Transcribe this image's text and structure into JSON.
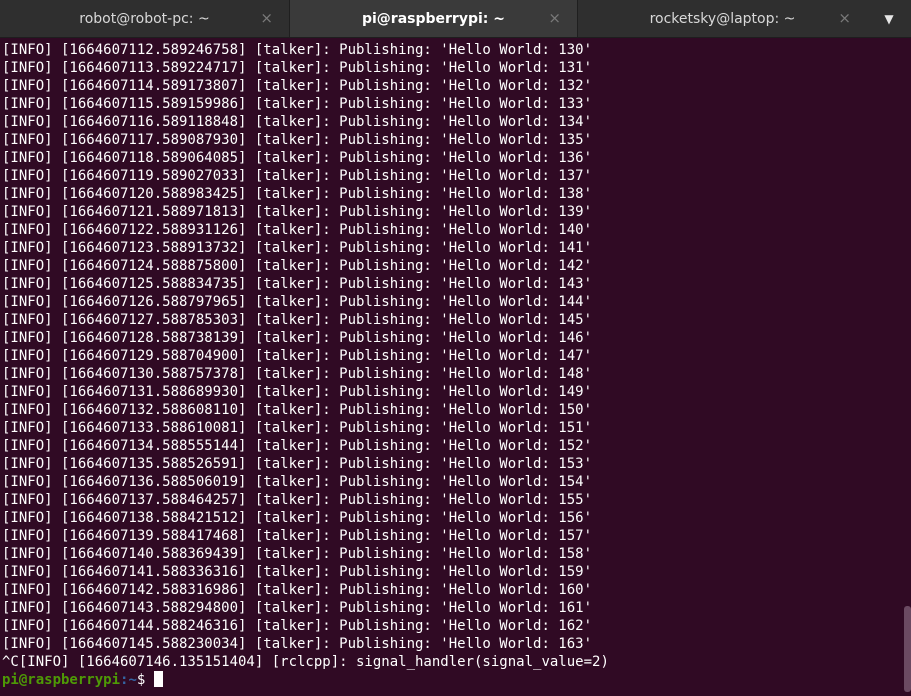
{
  "tabs": [
    {
      "label": "robot@robot-pc: ~",
      "close": "×"
    },
    {
      "label": "pi@raspberrypi: ~",
      "close": "×"
    },
    {
      "label": "rocketsky@laptop: ~",
      "close": "×"
    }
  ],
  "menu_icon": "▼",
  "terminal": {
    "lines": [
      "[INFO] [1664607112.589246758] [talker]: Publishing: 'Hello World: 130'",
      "[INFO] [1664607113.589224717] [talker]: Publishing: 'Hello World: 131'",
      "[INFO] [1664607114.589173807] [talker]: Publishing: 'Hello World: 132'",
      "[INFO] [1664607115.589159986] [talker]: Publishing: 'Hello World: 133'",
      "[INFO] [1664607116.589118848] [talker]: Publishing: 'Hello World: 134'",
      "[INFO] [1664607117.589087930] [talker]: Publishing: 'Hello World: 135'",
      "[INFO] [1664607118.589064085] [talker]: Publishing: 'Hello World: 136'",
      "[INFO] [1664607119.589027033] [talker]: Publishing: 'Hello World: 137'",
      "[INFO] [1664607120.588983425] [talker]: Publishing: 'Hello World: 138'",
      "[INFO] [1664607121.588971813] [talker]: Publishing: 'Hello World: 139'",
      "[INFO] [1664607122.588931126] [talker]: Publishing: 'Hello World: 140'",
      "[INFO] [1664607123.588913732] [talker]: Publishing: 'Hello World: 141'",
      "[INFO] [1664607124.588875800] [talker]: Publishing: 'Hello World: 142'",
      "[INFO] [1664607125.588834735] [talker]: Publishing: 'Hello World: 143'",
      "[INFO] [1664607126.588797965] [talker]: Publishing: 'Hello World: 144'",
      "[INFO] [1664607127.588785303] [talker]: Publishing: 'Hello World: 145'",
      "[INFO] [1664607128.588738139] [talker]: Publishing: 'Hello World: 146'",
      "[INFO] [1664607129.588704900] [talker]: Publishing: 'Hello World: 147'",
      "[INFO] [1664607130.588757378] [talker]: Publishing: 'Hello World: 148'",
      "[INFO] [1664607131.588689930] [talker]: Publishing: 'Hello World: 149'",
      "[INFO] [1664607132.588608110] [talker]: Publishing: 'Hello World: 150'",
      "[INFO] [1664607133.588610081] [talker]: Publishing: 'Hello World: 151'",
      "[INFO] [1664607134.588555144] [talker]: Publishing: 'Hello World: 152'",
      "[INFO] [1664607135.588526591] [talker]: Publishing: 'Hello World: 153'",
      "[INFO] [1664607136.588506019] [talker]: Publishing: 'Hello World: 154'",
      "[INFO] [1664607137.588464257] [talker]: Publishing: 'Hello World: 155'",
      "[INFO] [1664607138.588421512] [talker]: Publishing: 'Hello World: 156'",
      "[INFO] [1664607139.588417468] [talker]: Publishing: 'Hello World: 157'",
      "[INFO] [1664607140.588369439] [talker]: Publishing: 'Hello World: 158'",
      "[INFO] [1664607141.588336316] [talker]: Publishing: 'Hello World: 159'",
      "[INFO] [1664607142.588316986] [talker]: Publishing: 'Hello World: 160'",
      "[INFO] [1664607143.588294800] [talker]: Publishing: 'Hello World: 161'",
      "[INFO] [1664607144.588246316] [talker]: Publishing: 'Hello World: 162'",
      "[INFO] [1664607145.588230034] [talker]: Publishing: 'Hello World: 163'",
      "^C[INFO] [1664607146.135151404] [rclcpp]: signal_handler(signal_value=2)"
    ],
    "prompt_user_host": "pi@raspberrypi",
    "prompt_path": ":~",
    "prompt_symbol": "$"
  },
  "colors": {
    "background": "#300a24",
    "prompt_user": "#4e9a06",
    "prompt_path": "#3465a4"
  }
}
